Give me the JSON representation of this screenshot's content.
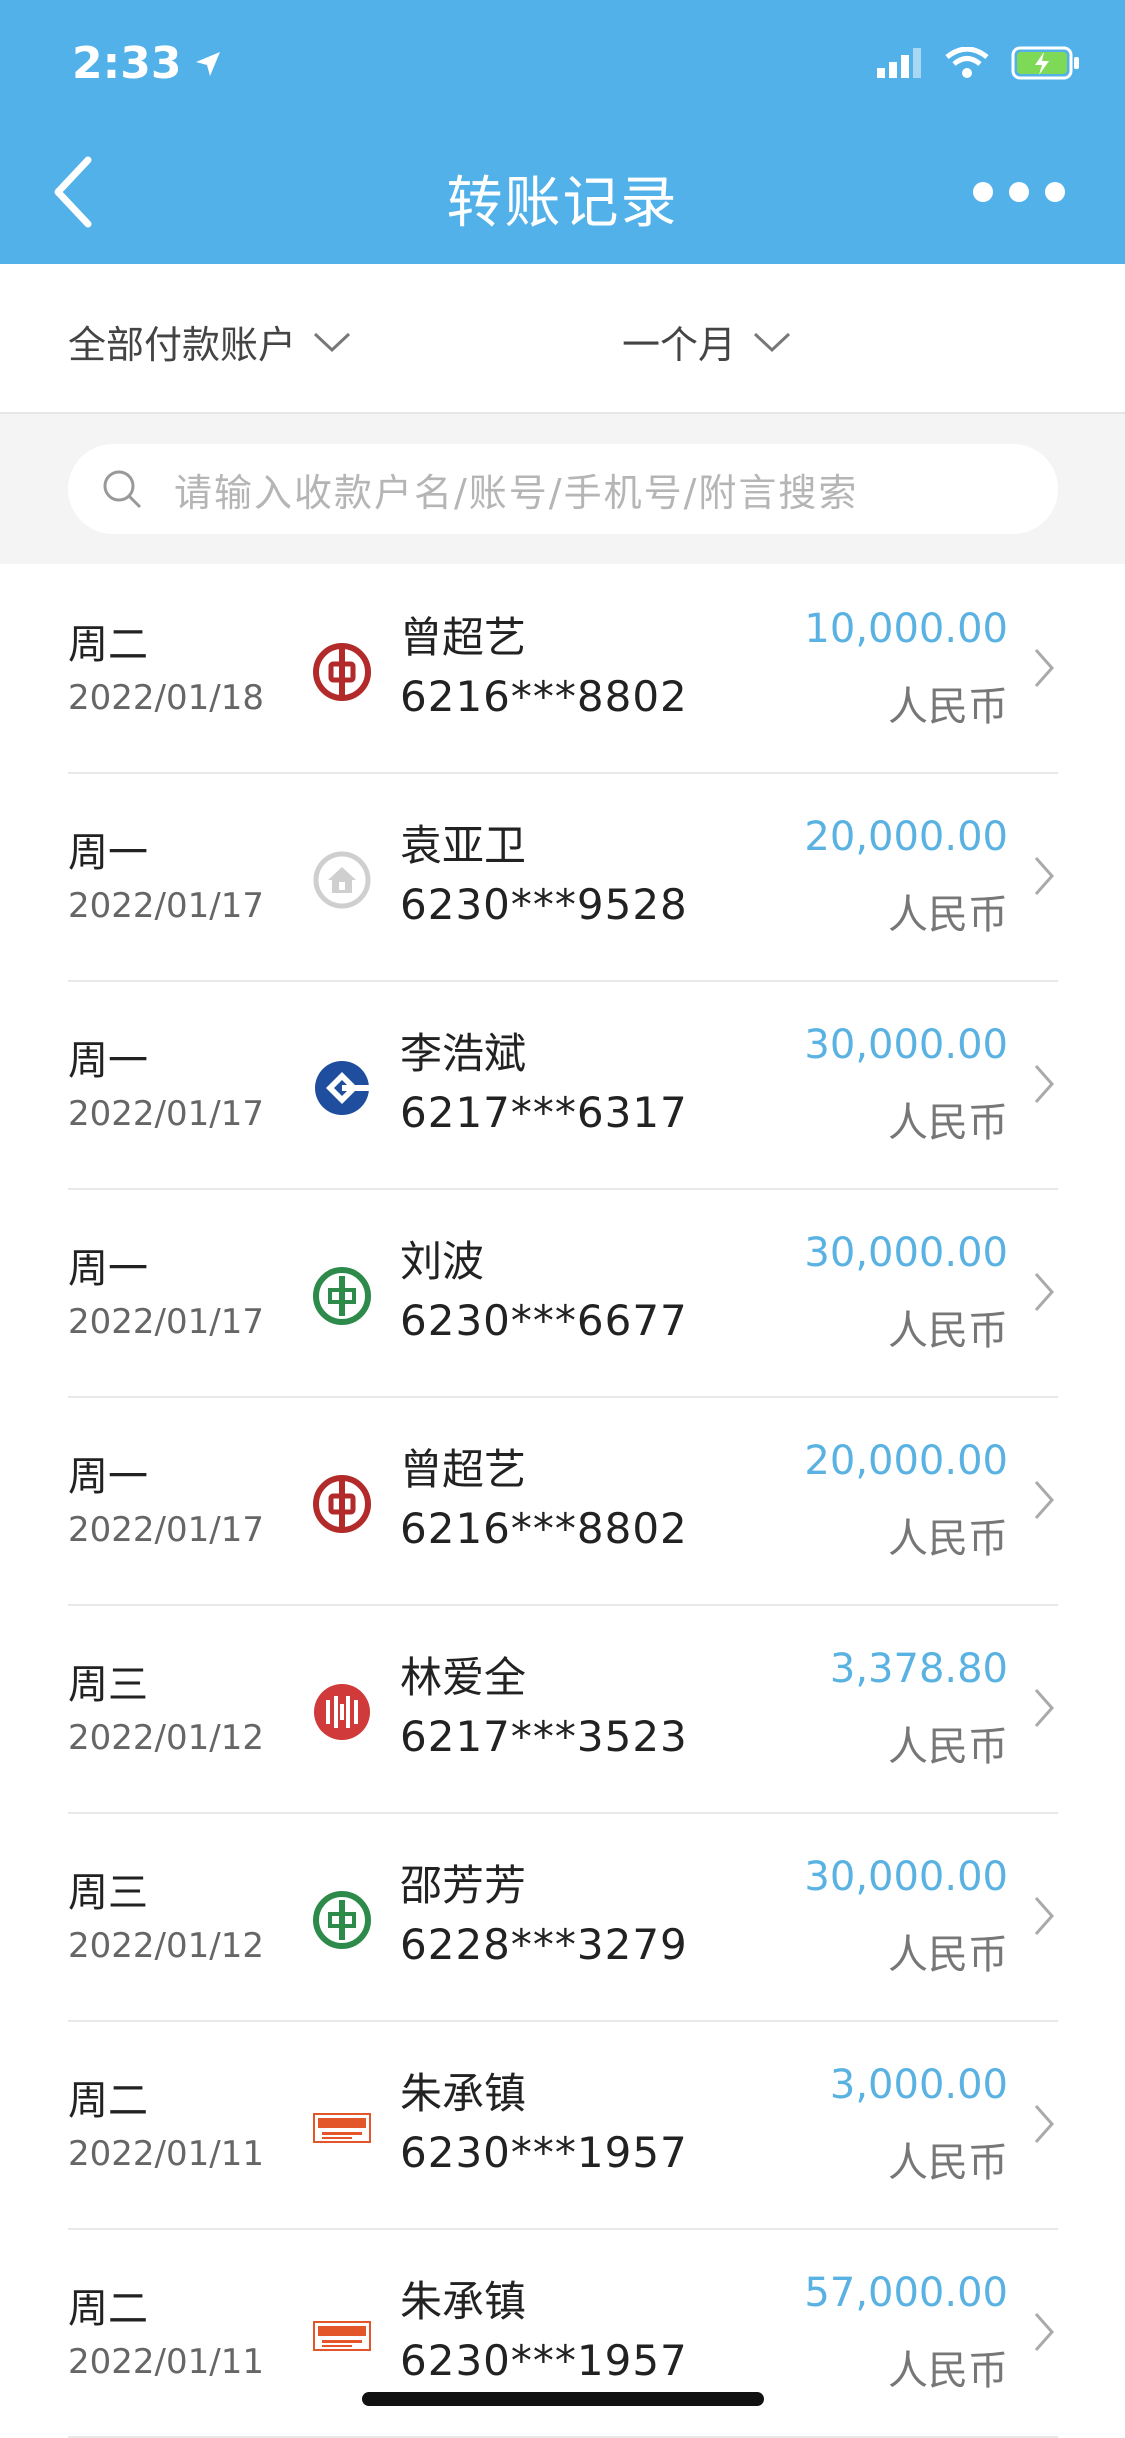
{
  "status_bar": {
    "time": "2:33"
  },
  "header": {
    "title": "转账记录"
  },
  "filters": {
    "account": "全部付款账户",
    "period": "一个月"
  },
  "search": {
    "placeholder": "请输入收款户名/账号/手机号/附言搜索"
  },
  "colors": {
    "header_bg": "#52b1e8",
    "amount": "#5ab2e2"
  },
  "records": [
    {
      "weekday": "周二",
      "date": "2022/01/18",
      "bank_icon": "boc-logo-icon",
      "name": "曾超艺",
      "account": "6216***8802",
      "amount": "10,000.00",
      "currency": "人民币"
    },
    {
      "weekday": "周一",
      "date": "2022/01/17",
      "bank_icon": "bank-house-logo-icon",
      "name": "袁亚卫",
      "account": "6230***9528",
      "amount": "20,000.00",
      "currency": "人民币"
    },
    {
      "weekday": "周一",
      "date": "2022/01/17",
      "bank_icon": "ccb-logo-icon",
      "name": "李浩斌",
      "account": "6217***6317",
      "amount": "30,000.00",
      "currency": "人民币"
    },
    {
      "weekday": "周一",
      "date": "2022/01/17",
      "bank_icon": "abc-logo-icon",
      "name": "刘波",
      "account": "6230***6677",
      "amount": "30,000.00",
      "currency": "人民币"
    },
    {
      "weekday": "周一",
      "date": "2022/01/17",
      "bank_icon": "boc-logo-icon",
      "name": "曾超艺",
      "account": "6216***8802",
      "amount": "20,000.00",
      "currency": "人民币"
    },
    {
      "weekday": "周三",
      "date": "2022/01/12",
      "bank_icon": "citic-logo-icon",
      "name": "林爱全",
      "account": "6217***3523",
      "amount": "3,378.80",
      "currency": "人民币"
    },
    {
      "weekday": "周三",
      "date": "2022/01/12",
      "bank_icon": "abc-logo-icon",
      "name": "邵芳芳",
      "account": "6228***3279",
      "amount": "30,000.00",
      "currency": "人民币"
    },
    {
      "weekday": "周二",
      "date": "2022/01/11",
      "bank_icon": "pingan-logo-icon",
      "name": "朱承镇",
      "account": "6230***1957",
      "amount": "3,000.00",
      "currency": "人民币"
    },
    {
      "weekday": "周二",
      "date": "2022/01/11",
      "bank_icon": "pingan-logo-icon",
      "name": "朱承镇",
      "account": "6230***1957",
      "amount": "57,000.00",
      "currency": "人民币"
    }
  ]
}
